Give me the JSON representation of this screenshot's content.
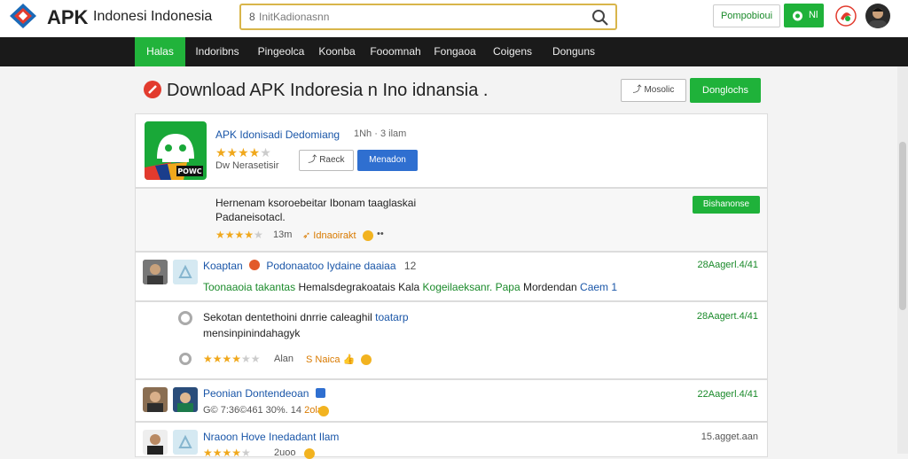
{
  "header": {
    "logo_apk": "APK",
    "logo_sub": "Indonesi Indonesia",
    "search_prefix": "8",
    "search_placeholder": "InitKadionasnn",
    "btn_outline": "Pompobioui",
    "btn_green": "Nl"
  },
  "nav": {
    "items": [
      {
        "label": "Halas",
        "active": true
      },
      {
        "label": "Indoribns",
        "active": false
      },
      {
        "label": "Pingeolca",
        "active": false
      },
      {
        "label": "Koonba",
        "active": false
      },
      {
        "label": "Fooomnah",
        "active": false
      },
      {
        "label": "Fongaoa",
        "active": false
      },
      {
        "label": "Coigens",
        "active": false
      },
      {
        "label": "Donguns",
        "active": false
      }
    ]
  },
  "page": {
    "title": "Download APK Indoresia n Ino idnansia .",
    "btn_outline": "Mosolic",
    "btn_green": "Donglochs"
  },
  "app": {
    "name": "APK Idonisadi Dedomiang",
    "meta": "1Nh · 3 ilam",
    "rating": 4,
    "developer": "Dw Nerasetisir",
    "btn_outline": "Raeck",
    "btn_primary": "Menadon",
    "icon_label": "POWC",
    "colors": {
      "accent": "#1fb23a",
      "primary": "#2f6fd0"
    }
  },
  "description": {
    "text_line1": "Hernenam ksoroebeitar Ibonam taaglaskai",
    "text_line2": "Padaneisotacl.",
    "badge": "Bishanonse",
    "rating": 3.5,
    "size": "13m",
    "tag": "Idnaoirakt",
    "tag_suffix": "••"
  },
  "rows": [
    {
      "title": "Koaptan",
      "title_part2": "Podonaatoo Iydaine daaiaa",
      "title_part3": "12",
      "sub_green": "Toonaaoia takantas",
      "sub_dark": "Hemalsdegrakoatais Kala",
      "sub_green2": "Kogeilaeksanr. Papa",
      "sub_dark2": "Mordendan",
      "sub_blue": "Caem 1",
      "date": "28Aagerl.4/41"
    },
    {
      "line1_dark": "Sekotan dentethoini dnrrie caleaghil",
      "line1_blue": "toatarp",
      "line2": "mensinpinindahagyk",
      "rating": 3.5,
      "size": "Alan",
      "tag": "S Naica",
      "date": "28Aagert.4/41"
    },
    {
      "title": "Peonian Dontendeoan",
      "meta": "G© 7:36©461 30%. 14",
      "tag": "2ola",
      "date": "22Aagerl.4/41"
    },
    {
      "title": "Nraoon Hove Inedadant Ilam",
      "size": "2uoo",
      "rating": 3.5,
      "date": "15.agget.aan"
    }
  ]
}
